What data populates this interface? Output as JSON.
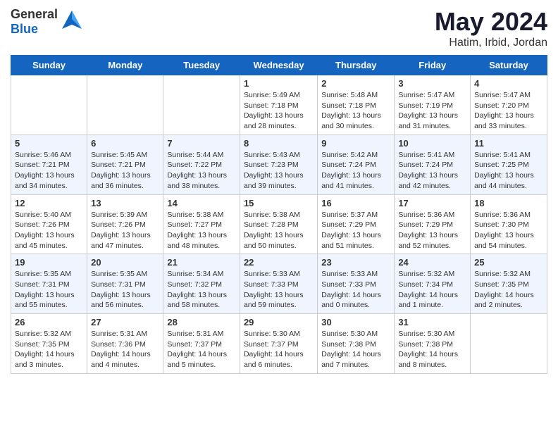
{
  "header": {
    "logo_general": "General",
    "logo_blue": "Blue",
    "month_year": "May 2024",
    "location": "Hatim, Irbid, Jordan"
  },
  "weekdays": [
    "Sunday",
    "Monday",
    "Tuesday",
    "Wednesday",
    "Thursday",
    "Friday",
    "Saturday"
  ],
  "weeks": [
    [
      {
        "day": "",
        "info": ""
      },
      {
        "day": "",
        "info": ""
      },
      {
        "day": "",
        "info": ""
      },
      {
        "day": "1",
        "info": "Sunrise: 5:49 AM\nSunset: 7:18 PM\nDaylight: 13 hours\nand 28 minutes."
      },
      {
        "day": "2",
        "info": "Sunrise: 5:48 AM\nSunset: 7:18 PM\nDaylight: 13 hours\nand 30 minutes."
      },
      {
        "day": "3",
        "info": "Sunrise: 5:47 AM\nSunset: 7:19 PM\nDaylight: 13 hours\nand 31 minutes."
      },
      {
        "day": "4",
        "info": "Sunrise: 5:47 AM\nSunset: 7:20 PM\nDaylight: 13 hours\nand 33 minutes."
      }
    ],
    [
      {
        "day": "5",
        "info": "Sunrise: 5:46 AM\nSunset: 7:21 PM\nDaylight: 13 hours\nand 34 minutes."
      },
      {
        "day": "6",
        "info": "Sunrise: 5:45 AM\nSunset: 7:21 PM\nDaylight: 13 hours\nand 36 minutes."
      },
      {
        "day": "7",
        "info": "Sunrise: 5:44 AM\nSunset: 7:22 PM\nDaylight: 13 hours\nand 38 minutes."
      },
      {
        "day": "8",
        "info": "Sunrise: 5:43 AM\nSunset: 7:23 PM\nDaylight: 13 hours\nand 39 minutes."
      },
      {
        "day": "9",
        "info": "Sunrise: 5:42 AM\nSunset: 7:24 PM\nDaylight: 13 hours\nand 41 minutes."
      },
      {
        "day": "10",
        "info": "Sunrise: 5:41 AM\nSunset: 7:24 PM\nDaylight: 13 hours\nand 42 minutes."
      },
      {
        "day": "11",
        "info": "Sunrise: 5:41 AM\nSunset: 7:25 PM\nDaylight: 13 hours\nand 44 minutes."
      }
    ],
    [
      {
        "day": "12",
        "info": "Sunrise: 5:40 AM\nSunset: 7:26 PM\nDaylight: 13 hours\nand 45 minutes."
      },
      {
        "day": "13",
        "info": "Sunrise: 5:39 AM\nSunset: 7:26 PM\nDaylight: 13 hours\nand 47 minutes."
      },
      {
        "day": "14",
        "info": "Sunrise: 5:38 AM\nSunset: 7:27 PM\nDaylight: 13 hours\nand 48 minutes."
      },
      {
        "day": "15",
        "info": "Sunrise: 5:38 AM\nSunset: 7:28 PM\nDaylight: 13 hours\nand 50 minutes."
      },
      {
        "day": "16",
        "info": "Sunrise: 5:37 AM\nSunset: 7:29 PM\nDaylight: 13 hours\nand 51 minutes."
      },
      {
        "day": "17",
        "info": "Sunrise: 5:36 AM\nSunset: 7:29 PM\nDaylight: 13 hours\nand 52 minutes."
      },
      {
        "day": "18",
        "info": "Sunrise: 5:36 AM\nSunset: 7:30 PM\nDaylight: 13 hours\nand 54 minutes."
      }
    ],
    [
      {
        "day": "19",
        "info": "Sunrise: 5:35 AM\nSunset: 7:31 PM\nDaylight: 13 hours\nand 55 minutes."
      },
      {
        "day": "20",
        "info": "Sunrise: 5:35 AM\nSunset: 7:31 PM\nDaylight: 13 hours\nand 56 minutes."
      },
      {
        "day": "21",
        "info": "Sunrise: 5:34 AM\nSunset: 7:32 PM\nDaylight: 13 hours\nand 58 minutes."
      },
      {
        "day": "22",
        "info": "Sunrise: 5:33 AM\nSunset: 7:33 PM\nDaylight: 13 hours\nand 59 minutes."
      },
      {
        "day": "23",
        "info": "Sunrise: 5:33 AM\nSunset: 7:33 PM\nDaylight: 14 hours\nand 0 minutes."
      },
      {
        "day": "24",
        "info": "Sunrise: 5:32 AM\nSunset: 7:34 PM\nDaylight: 14 hours\nand 1 minute."
      },
      {
        "day": "25",
        "info": "Sunrise: 5:32 AM\nSunset: 7:35 PM\nDaylight: 14 hours\nand 2 minutes."
      }
    ],
    [
      {
        "day": "26",
        "info": "Sunrise: 5:32 AM\nSunset: 7:35 PM\nDaylight: 14 hours\nand 3 minutes."
      },
      {
        "day": "27",
        "info": "Sunrise: 5:31 AM\nSunset: 7:36 PM\nDaylight: 14 hours\nand 4 minutes."
      },
      {
        "day": "28",
        "info": "Sunrise: 5:31 AM\nSunset: 7:37 PM\nDaylight: 14 hours\nand 5 minutes."
      },
      {
        "day": "29",
        "info": "Sunrise: 5:30 AM\nSunset: 7:37 PM\nDaylight: 14 hours\nand 6 minutes."
      },
      {
        "day": "30",
        "info": "Sunrise: 5:30 AM\nSunset: 7:38 PM\nDaylight: 14 hours\nand 7 minutes."
      },
      {
        "day": "31",
        "info": "Sunrise: 5:30 AM\nSunset: 7:38 PM\nDaylight: 14 hours\nand 8 minutes."
      },
      {
        "day": "",
        "info": ""
      }
    ]
  ]
}
